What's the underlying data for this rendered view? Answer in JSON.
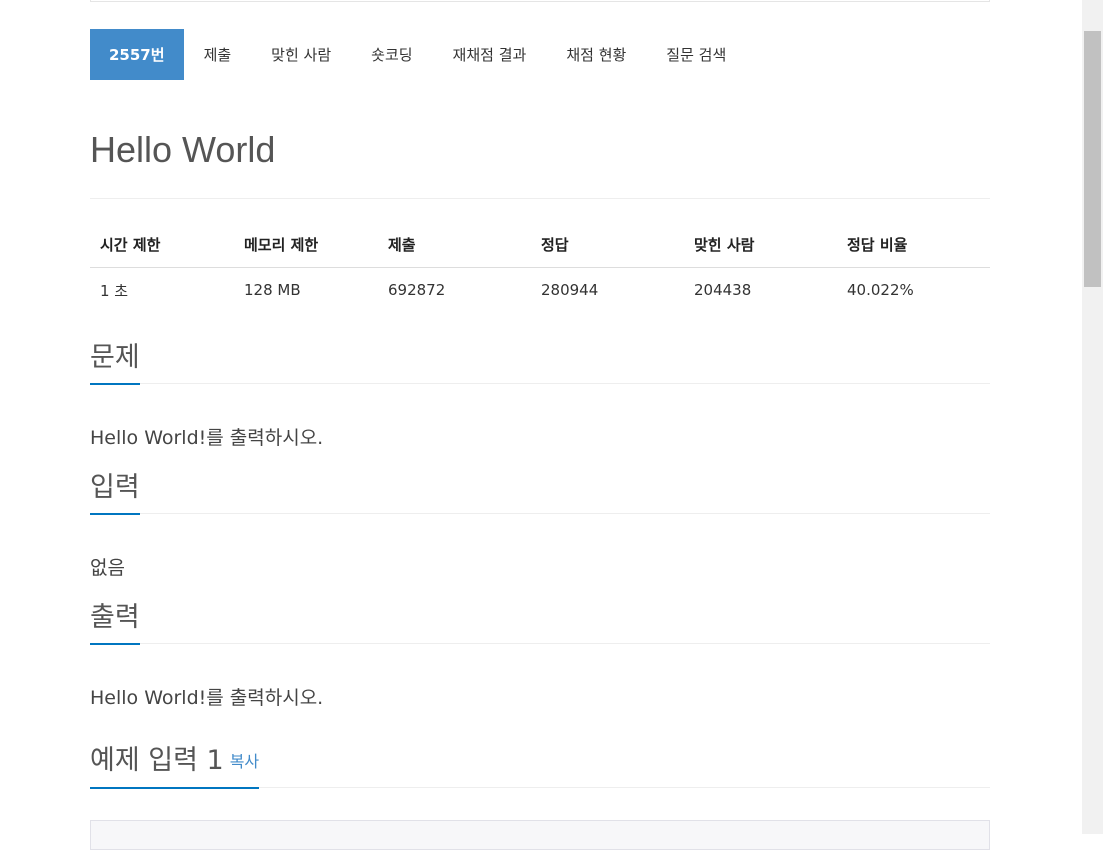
{
  "tabs": [
    {
      "label": "2557번",
      "active": true
    },
    {
      "label": "제출"
    },
    {
      "label": "맞힌 사람"
    },
    {
      "label": "숏코딩"
    },
    {
      "label": "재채점 결과"
    },
    {
      "label": "채점 현황"
    },
    {
      "label": "질문 검색"
    }
  ],
  "problem": {
    "title": "Hello World"
  },
  "info_table": {
    "headers": [
      "시간 제한",
      "메모리 제한",
      "제출",
      "정답",
      "맞힌 사람",
      "정답 비율"
    ],
    "values": [
      "1 초",
      "128 MB",
      "692872",
      "280944",
      "204438",
      "40.022%"
    ]
  },
  "sections": {
    "problem": {
      "heading": "문제",
      "body": "Hello World!를 출력하시오."
    },
    "input": {
      "heading": "입력",
      "body": "없음"
    },
    "output": {
      "heading": "출력",
      "body": "Hello World!를 출력하시오."
    },
    "sample_input": {
      "heading": "예제 입력 1",
      "copy_label": "복사"
    }
  },
  "colors": {
    "tab_active_bg": "#428bca",
    "section_underline": "#0076c0",
    "link": "#428bca"
  }
}
